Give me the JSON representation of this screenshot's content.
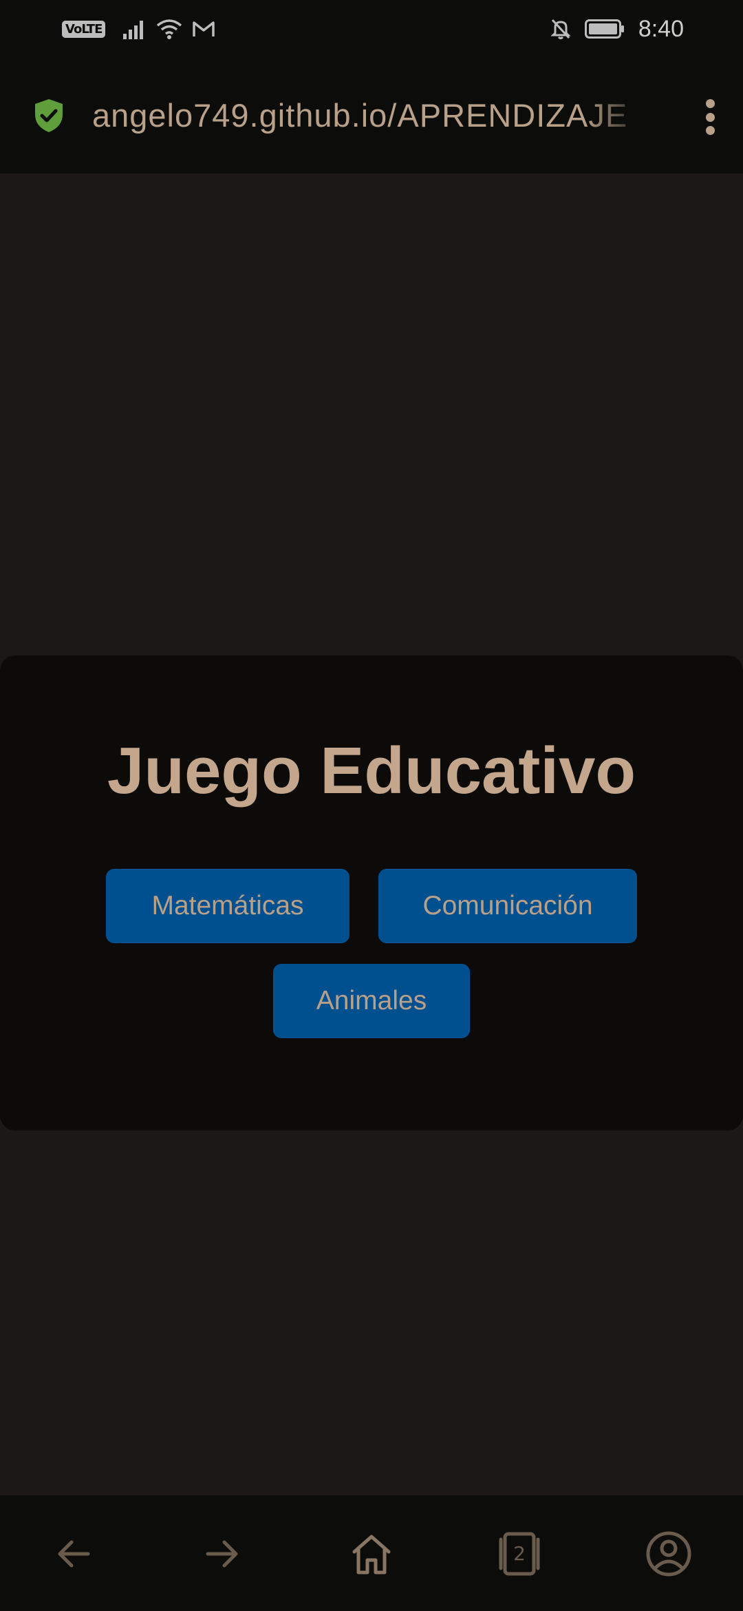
{
  "status_bar": {
    "network_badge": "VoLTE",
    "time": "8:40",
    "icons": [
      "volte-icon",
      "signal-icon",
      "wifi-icon",
      "gmail-icon",
      "mute-bell-icon",
      "battery-icon"
    ]
  },
  "browser": {
    "url": "angelo749.github.io/APRENDIZAJE",
    "secure_icon": "shield-check-icon",
    "menu_icon": "more-vertical-icon"
  },
  "game": {
    "title": "Juego Educativo",
    "buttons": {
      "math": "Matemáticas",
      "communication": "Comunicación",
      "animals": "Animales"
    }
  },
  "bottom_nav": {
    "tab_count": "2",
    "icons": [
      "back-arrow-icon",
      "forward-arrow-icon",
      "home-icon",
      "tabs-icon",
      "account-icon"
    ]
  },
  "colors": {
    "page_background": "#1b1815",
    "bar_background": "#0c0d0b",
    "panel_background": "#0d0b0a",
    "title_color": "#c4a68c",
    "button_background": "#00508f",
    "button_text": "#b9a089",
    "secure_green": "#5f9e3a",
    "nav_icon": "#6b5b4d"
  }
}
